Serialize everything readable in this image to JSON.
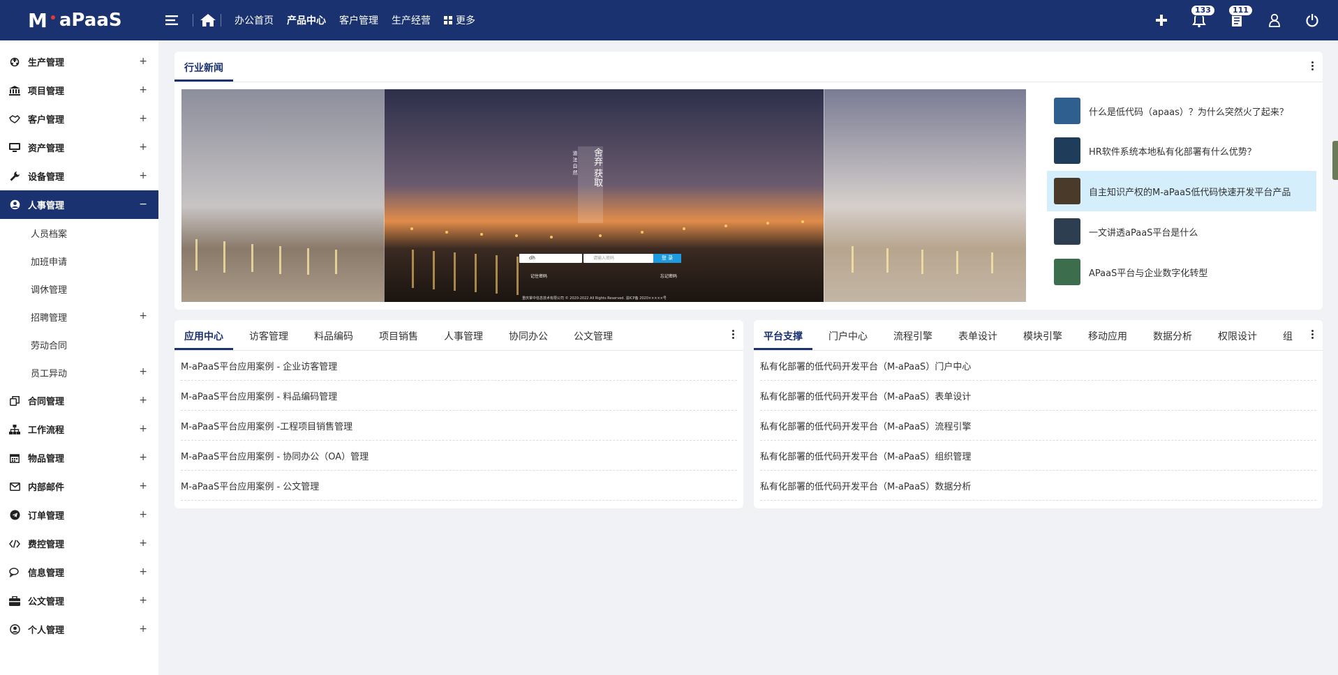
{
  "app": {
    "logo_mark": "M",
    "logo_text": "aPaaS"
  },
  "topnav": {
    "items": [
      "办公首页",
      "产品中心",
      "客户管理",
      "生产经营"
    ],
    "active_index": 1,
    "more_label": "更多"
  },
  "header_right": {
    "notifications_count": "133",
    "messages_count": "111"
  },
  "sidebar": {
    "items": [
      {
        "label": "生产管理",
        "icon": "recycle-icon",
        "toggle": "+"
      },
      {
        "label": "项目管理",
        "icon": "bank-icon",
        "toggle": "+"
      },
      {
        "label": "客户管理",
        "icon": "handshake-icon",
        "toggle": "+"
      },
      {
        "label": "资产管理",
        "icon": "monitor-icon",
        "toggle": "+"
      },
      {
        "label": "设备管理",
        "icon": "wrench-icon",
        "toggle": "+"
      },
      {
        "label": "人事管理",
        "icon": "user-circle-icon",
        "toggle": "−"
      }
    ],
    "subitems": [
      {
        "label": "人员档案",
        "toggle": ""
      },
      {
        "label": "加班申请",
        "toggle": ""
      },
      {
        "label": "调休管理",
        "toggle": ""
      },
      {
        "label": "招聘管理",
        "toggle": "+"
      },
      {
        "label": "劳动合同",
        "toggle": ""
      },
      {
        "label": "员工异动",
        "toggle": "+"
      }
    ],
    "items_after": [
      {
        "label": "合同管理",
        "icon": "copy-icon",
        "toggle": "+"
      },
      {
        "label": "工作流程",
        "icon": "sitemap-icon",
        "toggle": "+"
      },
      {
        "label": "物品管理",
        "icon": "calendar-icon",
        "toggle": "+"
      },
      {
        "label": "内部邮件",
        "icon": "mail-icon",
        "toggle": "+"
      },
      {
        "label": "订单管理",
        "icon": "telegram-icon",
        "toggle": "+"
      },
      {
        "label": "费控管理",
        "icon": "code-icon",
        "toggle": "+"
      },
      {
        "label": "信息管理",
        "icon": "chat-icon",
        "toggle": "+"
      },
      {
        "label": "公文管理",
        "icon": "briefcase-icon",
        "toggle": "+"
      },
      {
        "label": "个人管理",
        "icon": "user-icon",
        "toggle": "+"
      }
    ]
  },
  "news_card": {
    "tab": "行业新闻",
    "items": [
      "什么是低代码（apaas）？为什么突然火了起来？",
      "HR软件系统本地私有化部署有什么优势？",
      "自主知识产权的M-aPaaS低代码快速开发平台产品",
      "一文讲透aPaaS平台是什么",
      "APaaS平台与企业数字化转型"
    ],
    "highlight_index": 2,
    "thumb_colors": [
      "#2f5f8f",
      "#1f3d5a",
      "#4a3a2a",
      "#2c3e50",
      "#3c6e4e"
    ]
  },
  "carousel": {
    "login_user": "dh",
    "login_password": "请输入密码",
    "login_button": "登 录",
    "remember_label": "记住密码",
    "forgot_label": "忘记密码",
    "poem_right": "舍弃 获取",
    "poem_left": "道 法 自 然 ",
    "footer": "重庆掌中信息技术有限公司 © 2020-2022 All Rights Reserved. 渝ICP备 2020×××××号"
  },
  "app_center_card": {
    "tabs": [
      "应用中心",
      "访客管理",
      "料品编码",
      "项目销售",
      "人事管理",
      "协同办公",
      "公文管理"
    ],
    "active_index": 0,
    "rows": [
      "M-aPaaS平台应用案例 - 企业访客管理",
      "M-aPaaS平台应用案例 - 料品编码管理",
      "M-aPaaS平台应用案例 -工程项目销售管理",
      "M-aPaaS平台应用案例 - 协同办公（OA）管理",
      "M-aPaaS平台应用案例 - 公文管理"
    ]
  },
  "platform_card": {
    "tabs": [
      "平台支撑",
      "门户中心",
      "流程引擎",
      "表单设计",
      "模块引擎",
      "移动应用",
      "数据分析",
      "权限设计",
      "组"
    ],
    "active_index": 0,
    "rows": [
      "私有化部署的低代码开发平台（M-aPaaS）门户中心",
      "私有化部署的低代码开发平台（M-aPaaS）表单设计",
      "私有化部署的低代码开发平台（M-aPaaS）流程引擎",
      "私有化部署的低代码开发平台（M-aPaaS）组织管理",
      "私有化部署的低代码开发平台（M-aPaaS）数据分析"
    ]
  },
  "colors": {
    "brand": "#1b3270",
    "highlight": "#d4eefb",
    "accent_button": "#1e9be0"
  }
}
